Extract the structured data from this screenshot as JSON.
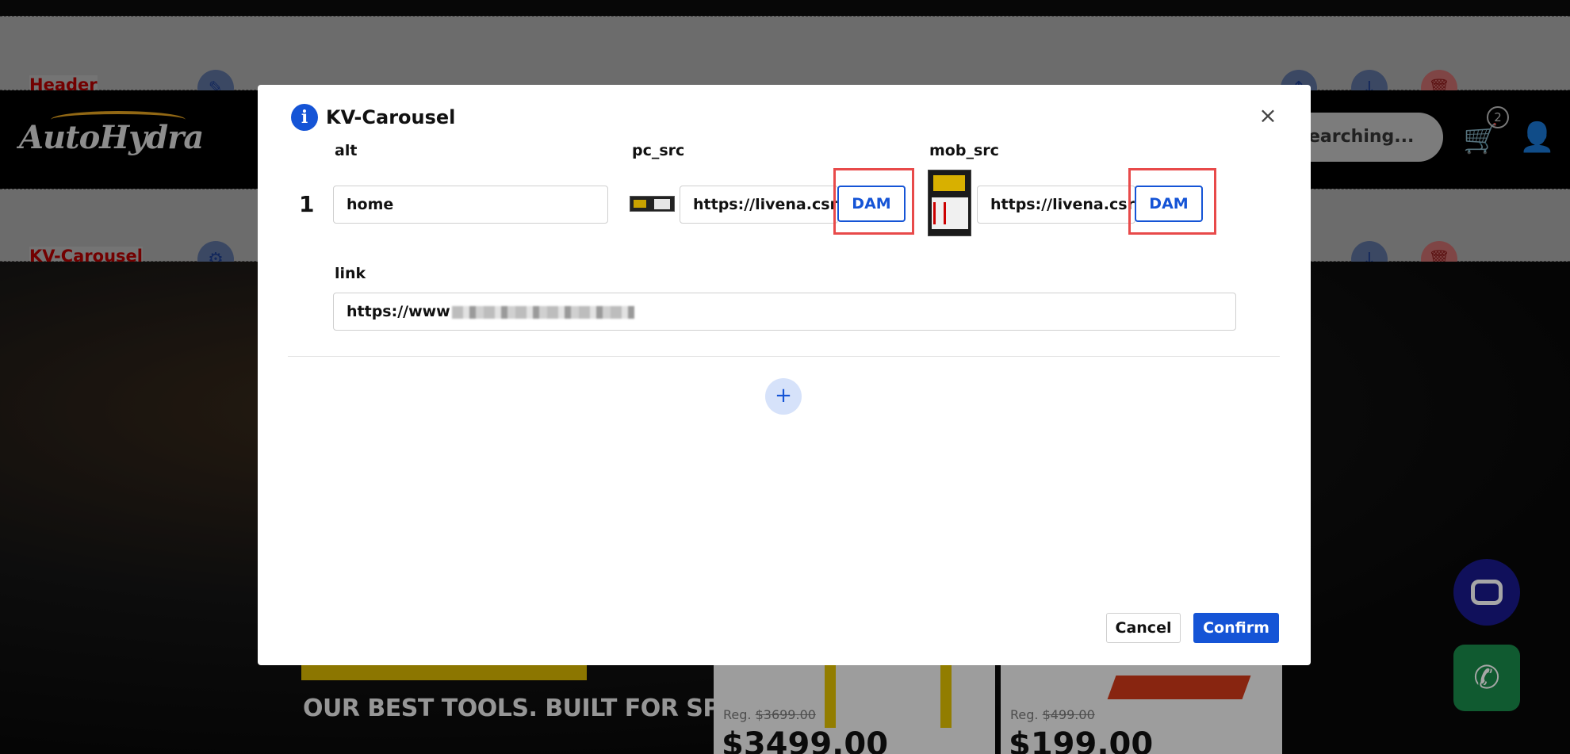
{
  "background": {
    "section_labels": [
      "Header",
      "KV-Carousel"
    ],
    "logo_text": "AutoHydra",
    "search_placeholder": "earching...",
    "cart_count": "2",
    "promo_text": "OUR BEST TOOLS. BUILT FOR SPRING.",
    "products": [
      {
        "reg_label": "Reg.",
        "reg_price": "$3699.00",
        "price": "$3499.00"
      },
      {
        "reg_label": "Reg.",
        "reg_price": "$499.00",
        "price": "$199.00"
      }
    ]
  },
  "modal": {
    "title": "KV-Carousel",
    "columns": {
      "alt": "alt",
      "pc_src": "pc_src",
      "mob_src": "mob_src",
      "link": "link"
    },
    "rows": [
      {
        "index": "1",
        "alt": "home",
        "pc_src": "https://livena.csr",
        "mob_src": "https://livena.csr",
        "link": "https://www"
      }
    ],
    "dam_label": "DAM",
    "add_symbol": "+",
    "cancel_label": "Cancel",
    "confirm_label": "Confirm",
    "close_symbol": "×",
    "info_symbol": "i"
  },
  "colors": {
    "accent": "#1554d6",
    "highlight": "#e84a4a",
    "label_red": "#b00000"
  }
}
